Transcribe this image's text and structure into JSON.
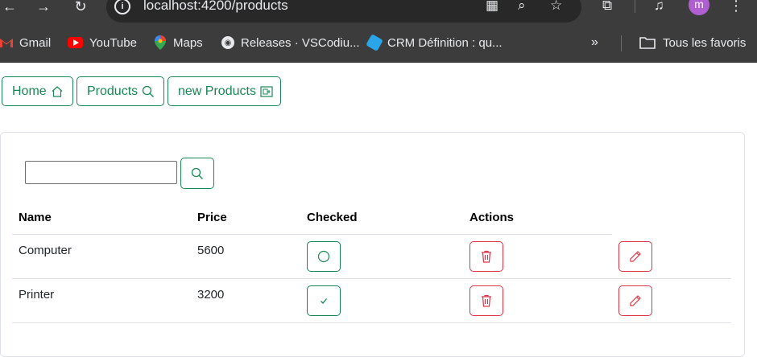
{
  "browser": {
    "url": "localhost:4200/products",
    "profile_initial": "m",
    "bookmarks": [
      {
        "label": "Gmail",
        "icon": "gmail-icon"
      },
      {
        "label": "YouTube",
        "icon": "youtube-icon"
      },
      {
        "label": "Maps",
        "icon": "maps-icon"
      },
      {
        "label": "Releases · VSCodiu...",
        "icon": "github-icon"
      },
      {
        "label": "CRM Définition : qu...",
        "icon": "cube-icon"
      }
    ],
    "all_bookmarks_label": "Tous les favoris"
  },
  "nav": {
    "home_label": "Home",
    "products_label": "Products",
    "new_products_label": "new Products"
  },
  "search": {
    "value": ""
  },
  "table": {
    "headers": [
      "Name",
      "Price",
      "Checked",
      "Actions"
    ],
    "rows": [
      {
        "name": "Computer",
        "price": "5600",
        "checked": false
      },
      {
        "name": "Printer",
        "price": "3200",
        "checked": true
      }
    ]
  },
  "colors": {
    "success": "#198754",
    "danger": "#dc3545",
    "chrome": "#3c3c3c"
  }
}
